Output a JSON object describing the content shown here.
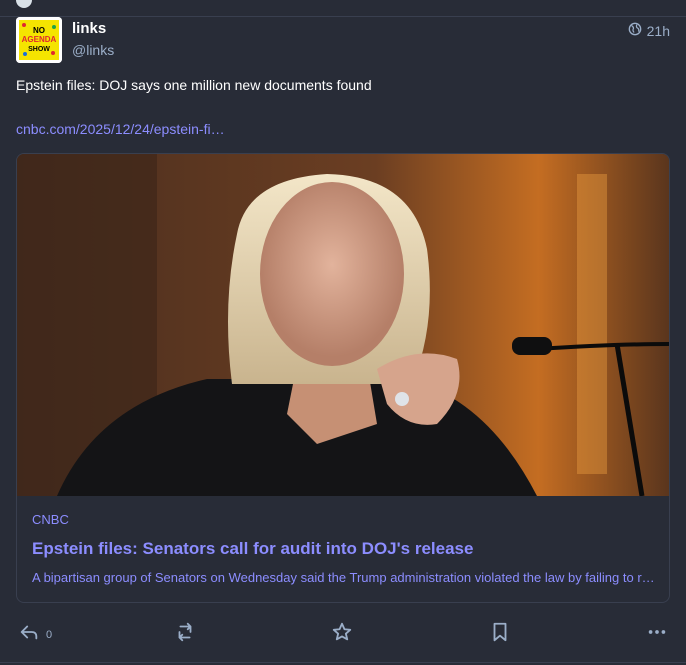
{
  "post": {
    "display_name": "links",
    "handle": "@links",
    "visibility_icon": "globe-icon",
    "time": "21h",
    "content": "Epstein files: DOJ says one million new documents found",
    "link_text": "cnbc.com/2025/12/24/epstein-fi…",
    "avatar_text": [
      "NO",
      "AGENDA",
      "SHOW"
    ]
  },
  "card": {
    "provider": "CNBC",
    "title": "Epstein files: Senators call for audit into DOJ's release",
    "description": "A bipartisan group of Senators on Wednesday said the Trump administration violated the law by failing to release all of the Epstein files."
  },
  "actions": {
    "reply_count": "0",
    "icons": [
      "reply-icon",
      "boost-icon",
      "favourite-icon",
      "bookmark-icon",
      "more-icon"
    ]
  },
  "colors": {
    "background": "#282c37",
    "accent_link": "#8c8dff",
    "muted": "#9baec8",
    "border": "#393f4f"
  }
}
